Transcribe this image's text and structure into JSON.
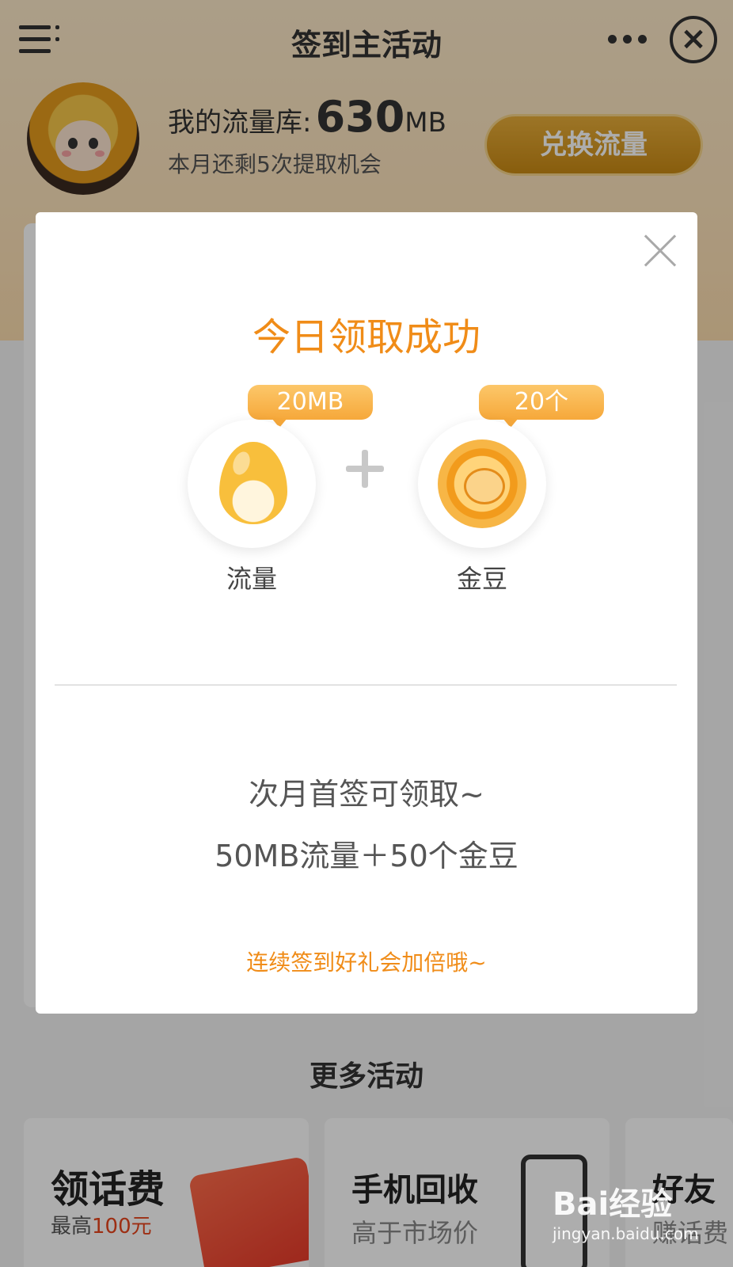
{
  "header": {
    "title": "签到主活动",
    "menu_icon": "menu-icon",
    "more_icon": "more-icon",
    "close_icon": "close-icon"
  },
  "profile": {
    "flow_label": "我的流量库:",
    "flow_value": "630",
    "flow_unit": "MB",
    "chances_text": "本月还剩5次提取机会",
    "exchange_button": "兑换流量"
  },
  "modal": {
    "title": "今日领取成功",
    "rewards": [
      {
        "tag": "20MB",
        "label": "流量",
        "icon": "data-drop-icon"
      },
      {
        "tag": "20个",
        "label": "金豆",
        "icon": "gold-bean-icon"
      }
    ],
    "next_month_line1": "次月首签可领取~",
    "next_month_line2": "50MB流量＋50个金豆",
    "bonus_text": "连续签到好礼会加倍哦~"
  },
  "more_activities": {
    "title": "更多活动",
    "cards": [
      {
        "title": "领话费",
        "sub_prefix": "最高",
        "sub_highlight": "100元"
      },
      {
        "title": "手机回收",
        "sub": "高于市场价"
      },
      {
        "title": "好友",
        "sub": "赚话费"
      }
    ]
  },
  "watermark": {
    "logo": "Bai经验",
    "url": "jingyan.baidu.com"
  },
  "colors": {
    "accent": "#f08c18",
    "header_bg": "#fde3bb",
    "highlight_red": "#e8451c"
  }
}
